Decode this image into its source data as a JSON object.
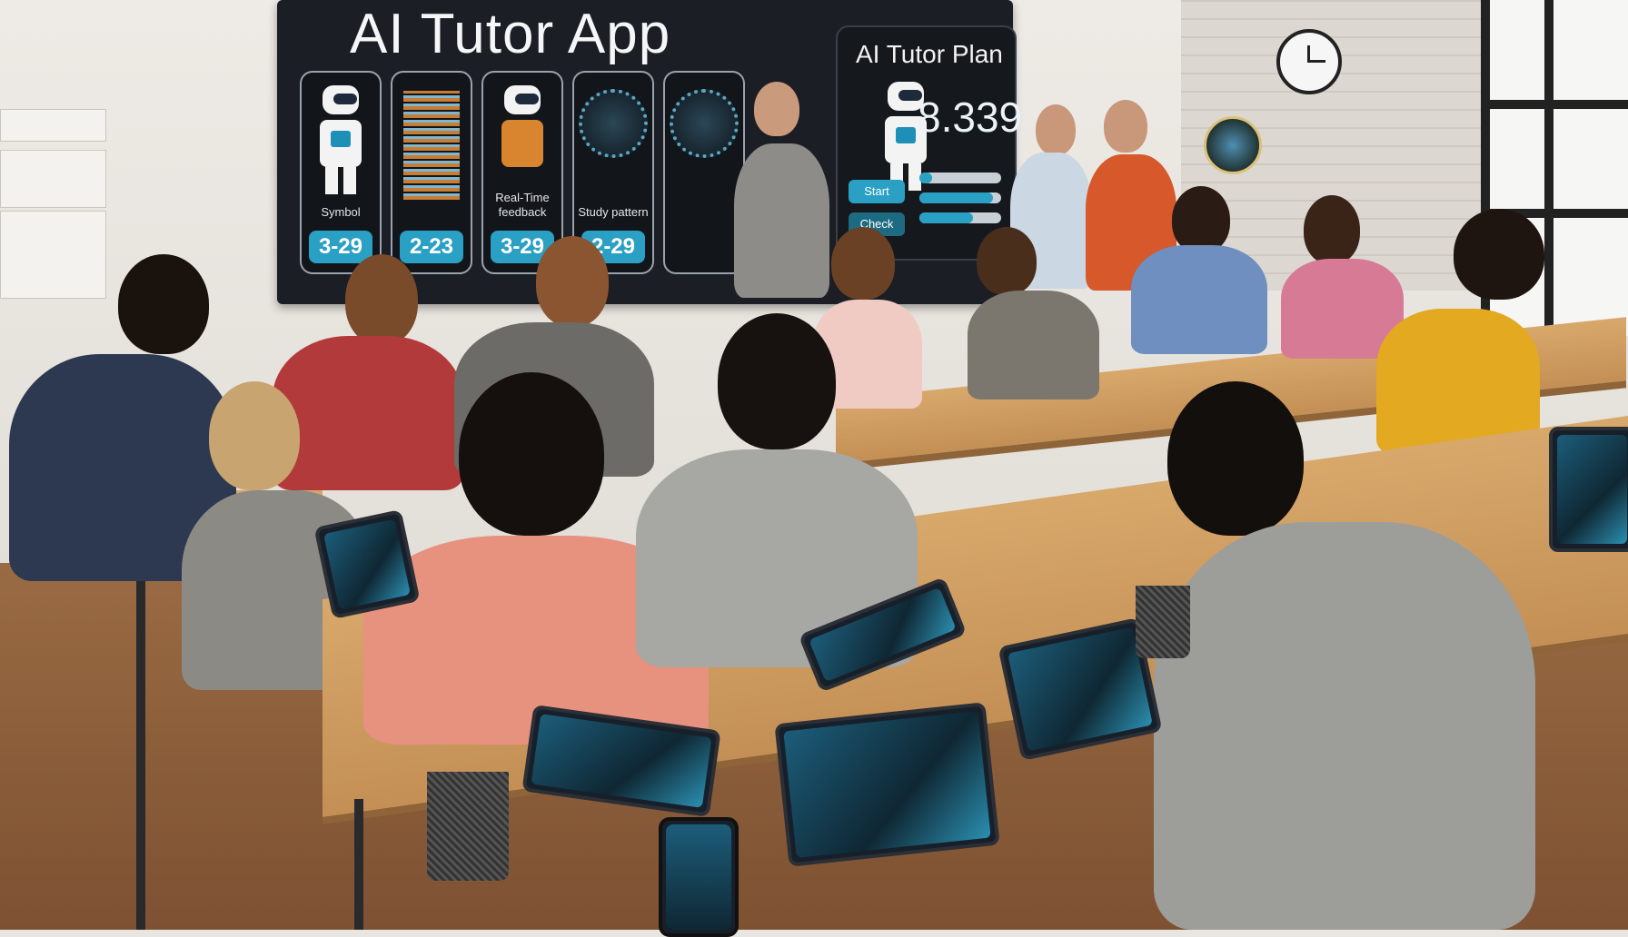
{
  "scene": {
    "description": "Students in a classroom using tablets, phones and laptops with an AI tutor app, in front of a large wall display"
  },
  "wall_display": {
    "title": "AI Tutor App",
    "cards": [
      {
        "icon": "robot-icon",
        "label": "Symbol",
        "value": "3-29"
      },
      {
        "icon": "bar-chart-icon",
        "label": "",
        "value": "2-23"
      },
      {
        "icon": "robot-icon",
        "label": "Real-Time feedback",
        "value": "3-29"
      },
      {
        "icon": "dial-icon",
        "label": "Study pattern",
        "value": "2-29"
      },
      {
        "icon": "dial-icon",
        "label": "",
        "value": ""
      }
    ]
  },
  "side_panel": {
    "title": "AI Tutor Plan",
    "metric": "8.339",
    "buttons": [
      "Start",
      "Check"
    ],
    "progress": [
      0.15,
      0.9,
      0.65
    ]
  },
  "colors": {
    "accent": "#2aa0c4",
    "board_bg": "#1b1e24",
    "desk": "#d8a86b"
  }
}
